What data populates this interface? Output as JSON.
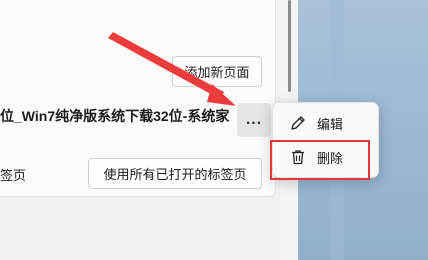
{
  "page": {
    "add_new_page_button": "添加新页面",
    "page_entry_title": "位_Win7纯净版系统下载32位-系统家",
    "setting_label": "签页",
    "use_open_tabs_button": "使用所有已打开的标签页",
    "more_button": "..."
  },
  "context_menu": {
    "items": [
      {
        "label": "编辑",
        "icon": "pencil-icon"
      },
      {
        "label": "删除",
        "icon": "trash-icon"
      }
    ]
  },
  "colors": {
    "highlight": "#e23a3a",
    "desktop_blue": "#8fb0cd"
  }
}
